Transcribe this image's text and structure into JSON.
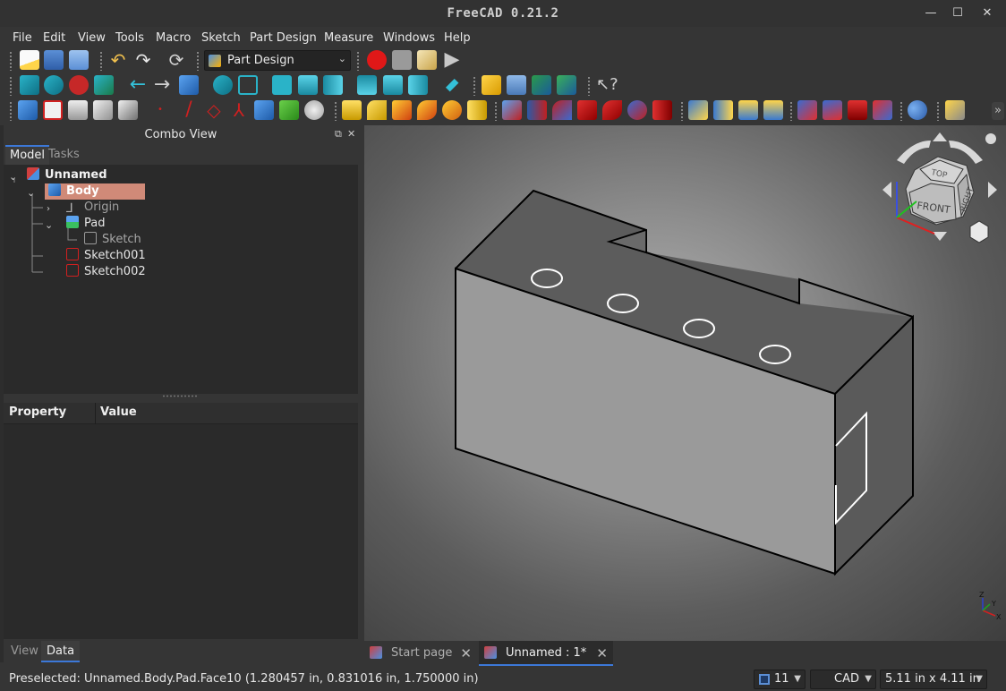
{
  "window": {
    "title": "FreeCAD 0.21.2",
    "minimize_icon": "minimize-icon",
    "maximize_icon": "maximize-icon",
    "close_icon": "close-icon"
  },
  "menu": [
    "File",
    "Edit",
    "View",
    "Tools",
    "Macro",
    "Sketch",
    "Part Design",
    "Measure",
    "Windows",
    "Help"
  ],
  "workbench": {
    "selected": "Part Design"
  },
  "combo_view": {
    "title": "Combo View",
    "tabs": [
      "Model",
      "Tasks"
    ],
    "tree": [
      {
        "label": "Unnamed",
        "level": 0,
        "bold": true
      },
      {
        "label": "Body",
        "level": 1,
        "bold": true,
        "selected": true
      },
      {
        "label": "Origin",
        "level": 2
      },
      {
        "label": "Pad",
        "level": 2
      },
      {
        "label": "Sketch",
        "level": 3
      },
      {
        "label": "Sketch001",
        "level": 2
      },
      {
        "label": "Sketch002",
        "level": 2
      }
    ],
    "property_columns": [
      "Property",
      "Value"
    ],
    "bottom_tabs": [
      "View",
      "Data"
    ]
  },
  "navcube": {
    "faces": [
      "TOP",
      "FRONT",
      "RIGHT"
    ]
  },
  "axes_labels": [
    "Z",
    "Y",
    "X"
  ],
  "document_tabs": [
    {
      "label": "Start page",
      "active": false
    },
    {
      "label": "Unnamed : 1*",
      "active": true
    }
  ],
  "status": {
    "text": "Preselected: Unnamed.Body.Pad.Face10 (1.280457 in, 0.831016 in, 1.750000 in)",
    "nav_count": "11",
    "nav_style": "CAD",
    "dimensions": "5.11 in x 4.11 in"
  },
  "colors": {
    "accent": "#3c78d8",
    "selection": "#d08a78",
    "background": "#353535"
  }
}
